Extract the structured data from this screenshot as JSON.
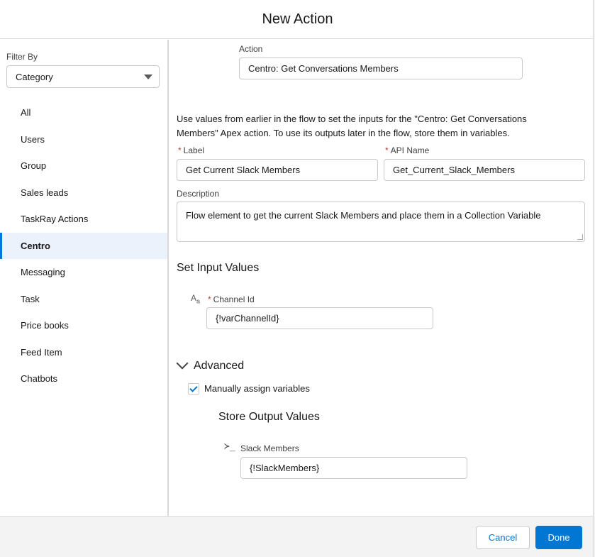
{
  "modal": {
    "title": "New Action"
  },
  "sidebar": {
    "filter_label": "Filter By",
    "filter_value": "Category",
    "items": [
      {
        "label": "All"
      },
      {
        "label": "Users"
      },
      {
        "label": "Group"
      },
      {
        "label": "Sales leads"
      },
      {
        "label": "TaskRay Actions"
      },
      {
        "label": "Centro",
        "selected": true
      },
      {
        "label": "Messaging"
      },
      {
        "label": "Task"
      },
      {
        "label": "Price books"
      },
      {
        "label": "Feed Item"
      },
      {
        "label": "Chatbots"
      }
    ]
  },
  "main": {
    "action_label": "Action",
    "action_value": "Centro: Get Conversations Members",
    "instructions": "Use values from earlier in the flow to set the inputs for the \"Centro: Get Conversations Members\" Apex action. To use its outputs later in the flow, store them in variables.",
    "required_marker": "*",
    "label_label": "Label",
    "label_value": "Get Current Slack Members",
    "api_name_label": "API Name",
    "api_name_value": "Get_Current_Slack_Members",
    "description_label": "Description",
    "description_value": "Flow element to get the current Slack Members and place them in a Collection Variable",
    "set_input_title": "Set Input Values",
    "text_type_icon": "A",
    "text_type_icon_sub": "a",
    "channel_id_label": "Channel Id",
    "channel_id_value": "{!varChannelId}",
    "advanced_title": "Advanced",
    "manual_assign_label": "Manually assign variables",
    "manual_assign_checked": true,
    "store_output_title": "Store Output Values",
    "output_icon": "≻_",
    "slack_members_label": "Slack Members",
    "slack_members_value": "{!SlackMembers}"
  },
  "footer": {
    "cancel_label": "Cancel",
    "done_label": "Done"
  },
  "colors": {
    "brand": "#0176d3",
    "required": "#c23934",
    "selected_bg": "#ebf2fc"
  }
}
